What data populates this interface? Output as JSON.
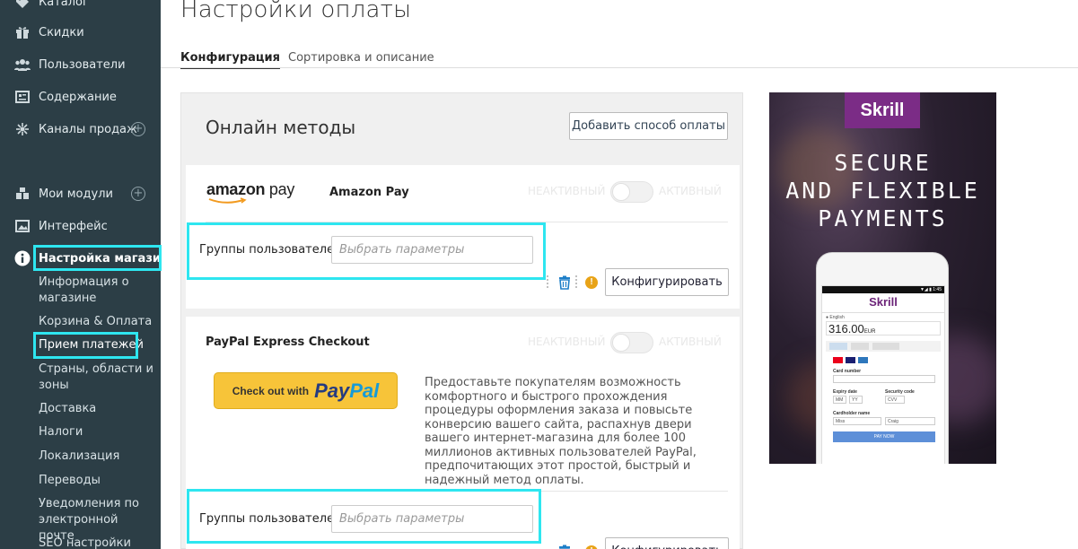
{
  "sidebar": {
    "items": [
      {
        "label": "Каталог",
        "icon": "tag-icon"
      },
      {
        "label": "Скидки",
        "icon": "gift-icon"
      },
      {
        "label": "Пользователи",
        "icon": "users-icon"
      },
      {
        "label": "Содержание",
        "icon": "content-icon"
      },
      {
        "label": "Каналы продаж",
        "icon": "sales-channels-icon"
      },
      {
        "label": "Мои модули",
        "icon": "puzzle-icon"
      },
      {
        "label": "Интерфейс",
        "icon": "picture-icon"
      },
      {
        "label": "Настройка магазина",
        "icon": "info-icon"
      }
    ],
    "subitems": [
      "Информация о магазине",
      "Корзина & Оплата",
      "Прием платежей",
      "Страны, области и зоны",
      "Доставка",
      "Налоги",
      "Локализация",
      "Переводы",
      "Уведомления по электронной почте",
      "SEO настройки"
    ],
    "plus": "+"
  },
  "header": {
    "title": "Настройки оплаты",
    "tabs": [
      "Конфигурация",
      "Сортировка и описание"
    ]
  },
  "panel": {
    "title": "Онлайн методы",
    "add_button": "Добавить способ оплаты"
  },
  "methods": [
    {
      "logo_text_a": "amazon",
      "logo_text_b": " pay",
      "name": "Amazon Pay",
      "toggle_off": "НЕАКТИВНЫЙ",
      "toggle_on": "АКТИВНЫЙ",
      "groups_label": "Группы пользователей",
      "groups_placeholder": "Выбрать параметры",
      "configure": "Конфигурировать"
    },
    {
      "name": "PayPal Express Checkout",
      "toggle_off": "НЕАКТИВНЫЙ",
      "toggle_on": "АКТИВНЫЙ",
      "button_prefix": "Check out with",
      "button_brand_a": "Pay",
      "button_brand_b": "Pal",
      "description": "Предоставьте покупателям возможность комфортного и быстрого прохождения процедуры оформления заказа и повысьте конверсию вашего сайта, распахнув двери вашего интернет-магазина для более 100 миллионов активных пользователей PayPal, предпочитающих этот простой, быстрый и надежный метод оплаты.",
      "groups_label": "Группы пользователей",
      "groups_placeholder": "Выбрать параметры",
      "configure": "Конфигурировать"
    }
  ],
  "ad": {
    "logo": "Skrill",
    "headline": [
      "SECURE",
      "AND FLEXIBLE",
      "PAYMENTS"
    ],
    "screen": {
      "status": "▼◢ ▮ 1:45",
      "logo": "Skrill",
      "lang": "● English",
      "amount": "316.00",
      "currency": "EUR",
      "card_number_label": "Card number",
      "expiry_label": "Expiry date",
      "mm": "MM",
      "yy": "YY",
      "security_label": "Security code",
      "cvv": "CVV",
      "cardholder_label": "Cardholder name",
      "first": "Miss",
      "last": "Craig",
      "pay": "PAY NOW"
    }
  },
  "colors": {
    "sidebar_bg": "#2c3e46",
    "highlight": "#2ee6f0",
    "skrill": "#7b2c86",
    "paypal_yellow": "#f7c439"
  }
}
